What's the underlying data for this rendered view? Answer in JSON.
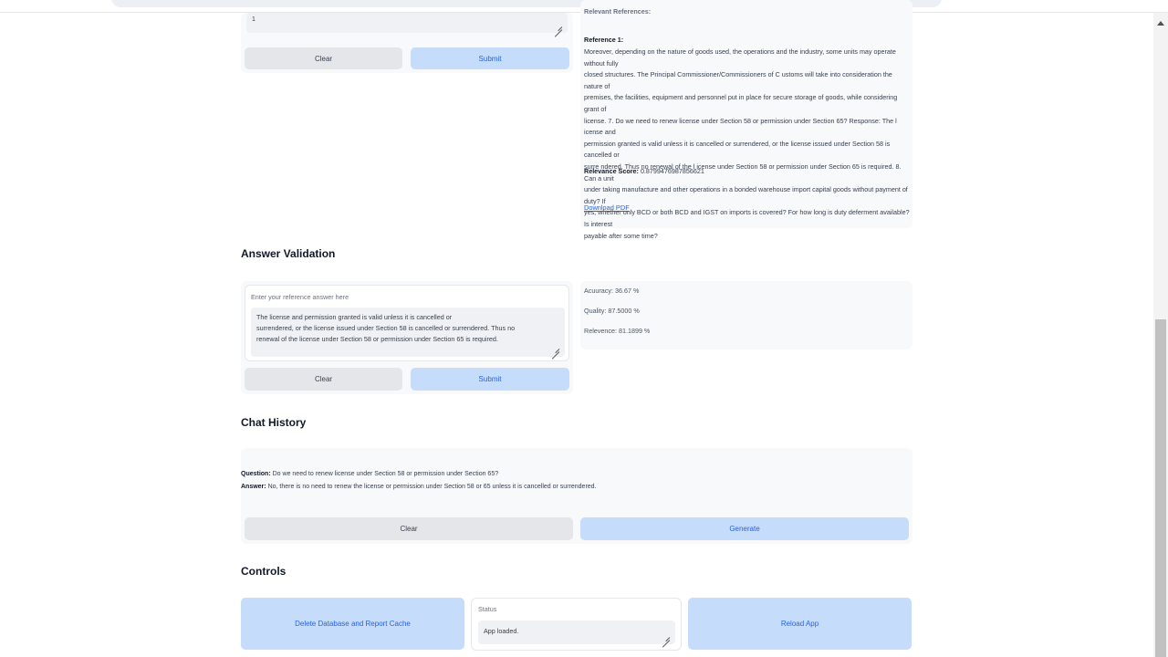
{
  "query_panel": {
    "input_value": "1",
    "clear_label": "Clear",
    "submit_label": "Submit"
  },
  "references": {
    "header_partial": "Relevant References:",
    "reference_title": "Reference 1:",
    "reference_lines": [
      "Moreover, depending on the nature of goods used, the operations and the industry, some units may operate without fully",
      "closed structures. The Principal Commissioner/Commissioners of C ustoms will take into consideration the nature of",
      "premises, the facilities, equipment and personnel put in place for secure storage of goods, while considering grant of",
      "license. 7. Do we need to renew license under Section 58 or permission under Section 65? Response: The l icense and",
      "permission granted is valid unless it is cancelled or surrendered, or the license issued under Section 58 is cancelled or",
      "surre ndered. Thus no renewal of the l icense under Section 58 or permission under Section 65 is required. 8. Can a unit",
      "under taking manufacture and other operations in a bonded warehouse import capital goods without payment of duty? If",
      "yes, whether only BCD or both BCD and IGST on imports is covered? For how long is duty deferment available? Is interest",
      "payable after some time?"
    ],
    "relevance_label": "Relevance Score:",
    "relevance_value": "0.8799476987856621",
    "download_link": "Download PDF"
  },
  "answer_validation": {
    "title": "Answer Validation",
    "input_label": "Enter your reference answer here",
    "answer_lines": [
      "The license and permission granted is valid unless it is cancelled or",
      "surrendered, or the license issued under Section 58 is cancelled or surrendered. Thus no",
      "renewal of the license under Section 58 or permission under Section 65 is required."
    ],
    "clear_label": "Clear",
    "submit_label": "Submit",
    "accuracy": "Acuuracy: 36.67 %",
    "quality": "Quality: 87.5000 %",
    "relevance": "Relevence: 81.1899 %"
  },
  "chat_history": {
    "title": "Chat History",
    "question_label": "Question:",
    "question_text": "Do we need to renew license under Section 58 or permission under Section 65?",
    "answer_label": "Answer:",
    "answer_text": "No, there is no need to renew the license or permission under Section 58 or 65 unless it is cancelled or surrendered.",
    "clear_label": "Clear",
    "generate_label": "Generate"
  },
  "controls": {
    "title": "Controls",
    "delete_label": "Delete Database and Report Cache",
    "status_label": "Status",
    "status_value": "App loaded.",
    "reload_label": "Reload App"
  },
  "colors": {
    "primary_button_bg": "#c5dcfb",
    "primary_button_text": "#2563eb",
    "secondary_button_bg": "#e4e6ea",
    "panel_bg": "#f8f9fb"
  }
}
